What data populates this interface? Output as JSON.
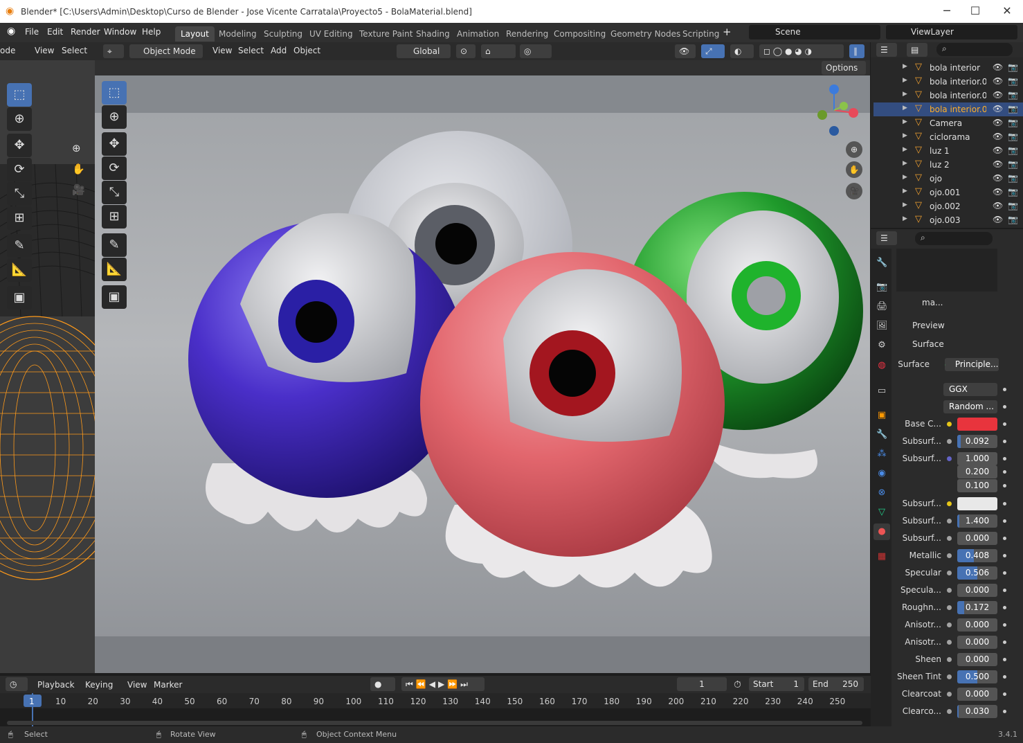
{
  "window": {
    "title": "Blender* [C:\\Users\\Admin\\Desktop\\Curso de Blender - Jose Vicente Carratala\\Proyecto5 - BolaMaterial.blend]",
    "minimize": "─",
    "maximize": "☐",
    "close": "✕"
  },
  "menu": {
    "file": "File",
    "edit": "Edit",
    "render": "Render",
    "window": "Window",
    "help": "Help"
  },
  "workspaces": [
    "Layout",
    "Modeling",
    "Sculpting",
    "UV Editing",
    "Texture Paint",
    "Shading",
    "Animation",
    "Rendering",
    "Compositing",
    "Geometry Nodes",
    "Scripting"
  ],
  "active_workspace": "Layout",
  "scene": {
    "label": "Scene",
    "view_layer": "ViewLayer"
  },
  "left_editor": {
    "mode_frag": "ode",
    "view": "View",
    "select": "Select"
  },
  "viewport": {
    "mode": "Object Mode",
    "view": "View",
    "select": "Select",
    "add": "Add",
    "object": "Object",
    "transform": "Global",
    "options": "Options"
  },
  "outliner": {
    "items": [
      {
        "name": "bola interior",
        "selected": false
      },
      {
        "name": "bola interior.0",
        "selected": false
      },
      {
        "name": "bola interior.0",
        "selected": false
      },
      {
        "name": "bola interior.0",
        "selected": true
      },
      {
        "name": "Camera",
        "selected": false
      },
      {
        "name": "ciclorama",
        "selected": false
      },
      {
        "name": "luz 1",
        "selected": false
      },
      {
        "name": "luz 2",
        "selected": false
      },
      {
        "name": "ojo",
        "selected": false
      },
      {
        "name": "ojo.001",
        "selected": false
      },
      {
        "name": "ojo.002",
        "selected": false
      },
      {
        "name": "ojo.003",
        "selected": false
      }
    ]
  },
  "properties": {
    "material_name": "ma...",
    "preview_label": "Preview",
    "surface_panel": "Surface",
    "surface_label": "Surface",
    "surface_value": "Principle...",
    "distribution": "GGX",
    "subsurface_method": "Random ...",
    "base_color_label": "Base C...",
    "base_color": "#e8343d",
    "rows": [
      {
        "label": "Subsurf...",
        "value": "0.092",
        "fill": 0.092
      },
      {
        "label": "Subsurf...",
        "value": "1.000",
        "fill": 0
      },
      {
        "label": "",
        "value": "0.200",
        "fill": 0
      },
      {
        "label": "",
        "value": "0.100",
        "fill": 0
      },
      {
        "label": "Subsurf...",
        "value": "",
        "fill": 0
      },
      {
        "label": "Subsurf...",
        "value": "1.400",
        "fill": 0.05
      },
      {
        "label": "Subsurf...",
        "value": "0.000",
        "fill": 0
      },
      {
        "label": "Metallic",
        "value": "0.408",
        "fill": 0.408
      },
      {
        "label": "Specular",
        "value": "0.506",
        "fill": 0.506
      },
      {
        "label": "Specula...",
        "value": "0.000",
        "fill": 0
      },
      {
        "label": "Roughn...",
        "value": "0.172",
        "fill": 0.172
      },
      {
        "label": "Anisotr...",
        "value": "0.000",
        "fill": 0
      },
      {
        "label": "Anisotr...",
        "value": "0.000",
        "fill": 0
      },
      {
        "label": "Sheen",
        "value": "0.000",
        "fill": 0
      },
      {
        "label": "Sheen Tint",
        "value": "0.500",
        "fill": 0.5
      },
      {
        "label": "Clearcoat",
        "value": "0.000",
        "fill": 0
      },
      {
        "label": "Clearco...",
        "value": "0.030",
        "fill": 0.03
      }
    ]
  },
  "timeline": {
    "playback": "Playback",
    "keying": "Keying",
    "view": "View",
    "marker": "Marker",
    "current_frame": "1",
    "start_label": "Start",
    "start": "1",
    "end_label": "End",
    "end": "250",
    "ticks": [
      "1",
      "10",
      "20",
      "30",
      "40",
      "50",
      "60",
      "70",
      "80",
      "90",
      "100",
      "110",
      "120",
      "130",
      "140",
      "150",
      "160",
      "170",
      "180",
      "190",
      "200",
      "210",
      "220",
      "230",
      "240",
      "250"
    ]
  },
  "statusbar": {
    "select": "Select",
    "rotate": "Rotate View",
    "context": "Object Context Menu",
    "version": "3.4.1"
  }
}
